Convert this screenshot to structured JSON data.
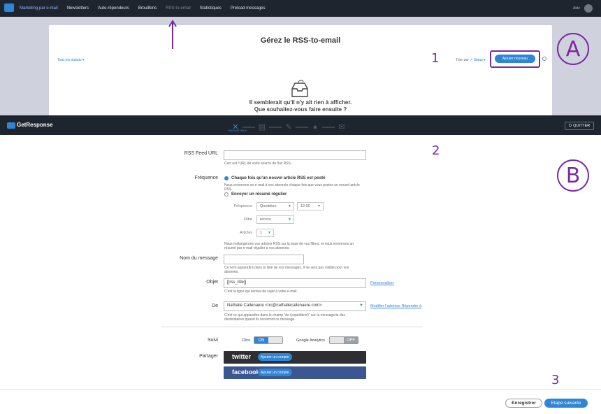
{
  "top_nav": {
    "items": [
      "Marketing par e-mail",
      "Newsletters",
      "Auto-répondeurs",
      "Brouillons",
      "RSS-to-email",
      "Statistiques",
      "Preload messages"
    ],
    "user": "Aide"
  },
  "rss_page": {
    "title": "Gérez le RSS-to-email",
    "status_filter": "Tous les statuts",
    "sort_label": "Trier par",
    "sort_value": "Statut",
    "add_button": "Ajouter nouveau",
    "empty_line1": "Il semblerait qu'il n'y ait rien à afficher.",
    "empty_line2": "Que souhaitez-vous faire ensuite ?"
  },
  "annotations": {
    "a": "A",
    "b": "B",
    "n1": "1",
    "n2": "2",
    "n3": "3"
  },
  "wizard": {
    "brand": "GetResponse",
    "step_label": "PARAMÈTRES",
    "quit_label": "QUITTER",
    "step_icons": [
      "tools-icon",
      "newsletter-icon",
      "edit-icon",
      "recipients-icon",
      "send-icon"
    ]
  },
  "form": {
    "feed_url_label": "RSS Feed URL",
    "feed_url_value": "",
    "feed_url_hint": "Ceci est l'URL de votre source de flux RSS.",
    "frequency_label": "Fréquence",
    "opt1": "Chaque fois qu'un nouvel article RSS est posté",
    "opt1_hint1": "Nous enverrons un e-mail à vos abonnés chaque fois que vous postez un nouvel article",
    "opt1_hint2": "RSS.",
    "opt2": "Envoyer un résumé régulier",
    "freq_sub": "Fréquence",
    "freq_value": "Quotidien",
    "time_value": "12:00",
    "filter_sub": "Filtre",
    "filter_value": "récent",
    "articles_sub": "Articles",
    "articles_value": "1",
    "summary_hint1": "Nous mélangerons vos articles RSS sur la base de vos filtres, et nous enverrons un",
    "summary_hint2": "résumé par e-mail régulier à vos abonnés.",
    "message_name_label": "Nom du message",
    "message_name_value": "",
    "message_name_hint1": "Ce nom apparaîtra dans la liste de vos messages. Il ne sera pas visible pour vos",
    "message_name_hint2": "abonnés.",
    "subject_label": "Objet",
    "subject_value": "[[rss_title]]",
    "subject_link": "Personnaliser",
    "subject_hint": "C'est la ligne qui servira de sujet à votre e-mail.",
    "from_label": "De",
    "from_value": "Nathalie Callenaere <nc@nathaliecallenaere.com>",
    "from_link": "Modifier l'adresse Répondre à",
    "from_hint1": "C'est ce qui apparaîtra dans le champ \"de (expéditeur)\" sur la messagerie des",
    "from_hint2": "destinataires quand ils recevront ce message.",
    "tracking_label": "Suivi",
    "clicks_label": "Clics",
    "clicks_state": "ON",
    "ga_label": "Google Analytics",
    "ga_state": "OFF",
    "share_label": "Partager",
    "twitter_name": "twitter",
    "twitter_button": "Ajouter un compte",
    "facebook_name": "facebook",
    "facebook_button": "Ajouter un compte"
  },
  "footer": {
    "save": "Enregistrer",
    "next": "Etape suivante"
  },
  "colors": {
    "accent": "#2f86d6",
    "annotation": "#7a2aa0",
    "nav_bg": "#1f252f"
  }
}
